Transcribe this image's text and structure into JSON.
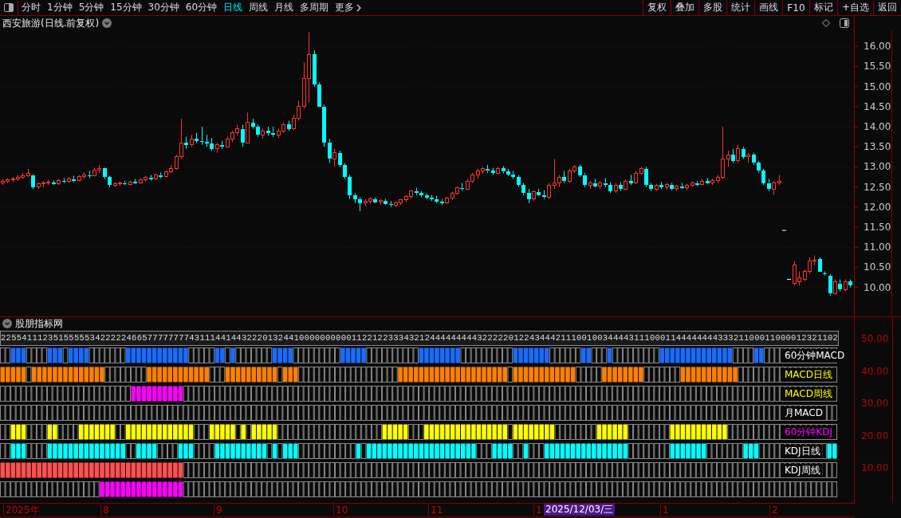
{
  "toolbar": {
    "periods": [
      {
        "label": "分时",
        "selected": false
      },
      {
        "label": "1分钟",
        "selected": false
      },
      {
        "label": "5分钟",
        "selected": false
      },
      {
        "label": "15分钟",
        "selected": false
      },
      {
        "label": "30分钟",
        "selected": false
      },
      {
        "label": "60分钟",
        "selected": false
      },
      {
        "label": "日线",
        "selected": true
      },
      {
        "label": "周线",
        "selected": false
      },
      {
        "label": "月线",
        "selected": false
      },
      {
        "label": "多周期",
        "selected": false
      }
    ],
    "more": "更多",
    "actions": [
      "复权",
      "叠加",
      "多股",
      "统计",
      "画线",
      "F10",
      "标记",
      "+自选",
      "返回"
    ]
  },
  "chart": {
    "title": "西安旅游(日线.前复权)",
    "chart_data": {
      "type": "candlestick",
      "ylim": [
        9.3,
        16.4
      ],
      "grid": true,
      "yticks": [
        {
          "value": 16,
          "label": "16.00"
        },
        {
          "value": 15.5,
          "label": "15.50"
        },
        {
          "value": 15,
          "label": "15.00"
        },
        {
          "value": 14.5,
          "label": "14.50"
        },
        {
          "value": 14,
          "label": "14.00"
        },
        {
          "value": 13.5,
          "label": "13.50"
        },
        {
          "value": 13,
          "label": "13.00"
        },
        {
          "value": 12.5,
          "label": "12.50"
        },
        {
          "value": 12,
          "label": "12.00"
        },
        {
          "value": 11.5,
          "label": "11.50"
        },
        {
          "value": 11,
          "label": "11.00"
        },
        {
          "value": 10.5,
          "label": "10.50"
        },
        {
          "value": 10,
          "label": "10.00"
        }
      ],
      "ohlc": [
        [
          12.6,
          12.7,
          12.55,
          12.65
        ],
        [
          12.65,
          12.72,
          12.6,
          12.68
        ],
        [
          12.68,
          12.75,
          12.62,
          12.7
        ],
        [
          12.7,
          12.8,
          12.65,
          12.75
        ],
        [
          12.75,
          12.85,
          12.7,
          12.78
        ],
        [
          12.78,
          12.95,
          12.75,
          12.85
        ],
        [
          12.8,
          12.82,
          12.45,
          12.5
        ],
        [
          12.5,
          12.62,
          12.45,
          12.58
        ],
        [
          12.58,
          12.65,
          12.5,
          12.6
        ],
        [
          12.6,
          12.68,
          12.55,
          12.62
        ],
        [
          12.62,
          12.66,
          12.55,
          12.58
        ],
        [
          12.58,
          12.7,
          12.55,
          12.66
        ],
        [
          12.66,
          12.72,
          12.6,
          12.64
        ],
        [
          12.64,
          12.75,
          12.6,
          12.7
        ],
        [
          12.7,
          12.78,
          12.62,
          12.66
        ],
        [
          12.66,
          12.8,
          12.64,
          12.76
        ],
        [
          12.76,
          12.86,
          12.7,
          12.8
        ],
        [
          12.8,
          12.9,
          12.72,
          12.78
        ],
        [
          12.78,
          12.98,
          12.76,
          12.92
        ],
        [
          12.92,
          13.05,
          12.85,
          12.96
        ],
        [
          12.96,
          12.98,
          12.7,
          12.75
        ],
        [
          12.75,
          12.78,
          12.5,
          12.55
        ],
        [
          12.55,
          12.62,
          12.5,
          12.58
        ],
        [
          12.58,
          12.64,
          12.52,
          12.6
        ],
        [
          12.6,
          12.65,
          12.55,
          12.57
        ],
        [
          12.57,
          12.66,
          12.54,
          12.63
        ],
        [
          12.63,
          12.7,
          12.58,
          12.6
        ],
        [
          12.6,
          12.72,
          12.58,
          12.68
        ],
        [
          12.68,
          12.78,
          12.64,
          12.74
        ],
        [
          12.74,
          12.8,
          12.66,
          12.7
        ],
        [
          12.7,
          12.84,
          12.68,
          12.8
        ],
        [
          12.8,
          12.86,
          12.72,
          12.76
        ],
        [
          12.76,
          12.92,
          12.74,
          12.88
        ],
        [
          12.88,
          13.05,
          12.85,
          12.95
        ],
        [
          12.95,
          13.3,
          12.93,
          13.25
        ],
        [
          13.25,
          14.2,
          13.2,
          13.6
        ],
        [
          13.6,
          13.75,
          13.45,
          13.55
        ],
        [
          13.55,
          13.8,
          13.5,
          13.7
        ],
        [
          13.7,
          13.85,
          13.6,
          13.65
        ],
        [
          13.65,
          14.0,
          13.55,
          13.62
        ],
        [
          13.62,
          13.8,
          13.5,
          13.58
        ],
        [
          13.58,
          13.72,
          13.4,
          13.45
        ],
        [
          13.45,
          13.6,
          13.35,
          13.55
        ],
        [
          13.55,
          13.65,
          13.45,
          13.5
        ],
        [
          13.5,
          13.75,
          13.48,
          13.7
        ],
        [
          13.7,
          13.9,
          13.62,
          13.85
        ],
        [
          13.85,
          14.05,
          13.78,
          13.95
        ],
        [
          13.95,
          14.05,
          13.5,
          13.6
        ],
        [
          13.6,
          14.35,
          13.58,
          14.1
        ],
        [
          14.1,
          14.2,
          13.95,
          14.0
        ],
        [
          14.0,
          14.05,
          13.75,
          13.8
        ],
        [
          13.8,
          13.95,
          13.7,
          13.9
        ],
        [
          13.9,
          14.0,
          13.78,
          13.85
        ],
        [
          13.85,
          14.0,
          13.75,
          13.8
        ],
        [
          13.8,
          13.95,
          13.72,
          13.9
        ],
        [
          13.9,
          14.1,
          13.85,
          14.05
        ],
        [
          14.05,
          14.15,
          13.9,
          13.95
        ],
        [
          13.95,
          14.3,
          13.92,
          14.2
        ],
        [
          14.2,
          14.65,
          14.15,
          14.5
        ],
        [
          14.5,
          15.6,
          14.45,
          15.2
        ],
        [
          15.2,
          16.35,
          14.6,
          15.8
        ],
        [
          15.8,
          15.9,
          15.0,
          15.05
        ],
        [
          15.05,
          15.1,
          14.5,
          14.5
        ],
        [
          14.5,
          14.55,
          13.5,
          13.6
        ],
        [
          13.6,
          13.7,
          13.1,
          13.2
        ],
        [
          13.2,
          13.45,
          13.0,
          13.35
        ],
        [
          13.35,
          13.4,
          13.0,
          13.05
        ],
        [
          13.05,
          13.1,
          12.7,
          12.75
        ],
        [
          12.75,
          12.8,
          12.2,
          12.3
        ],
        [
          12.3,
          12.35,
          12.1,
          12.2
        ],
        [
          12.2,
          12.25,
          11.9,
          12.1
        ],
        [
          12.1,
          12.2,
          12.02,
          12.15
        ],
        [
          12.15,
          12.25,
          12.08,
          12.2
        ],
        [
          12.2,
          12.24,
          12.1,
          12.12
        ],
        [
          12.12,
          12.2,
          12.05,
          12.16
        ],
        [
          12.16,
          12.2,
          12.06,
          12.08
        ],
        [
          12.08,
          12.15,
          12.0,
          12.05
        ],
        [
          12.05,
          12.14,
          12.0,
          12.1
        ],
        [
          12.1,
          12.2,
          12.05,
          12.18
        ],
        [
          12.18,
          12.3,
          12.12,
          12.26
        ],
        [
          12.26,
          12.42,
          12.22,
          12.4
        ],
        [
          12.4,
          12.48,
          12.3,
          12.35
        ],
        [
          12.35,
          12.4,
          12.25,
          12.3
        ],
        [
          12.3,
          12.34,
          12.2,
          12.24
        ],
        [
          12.24,
          12.3,
          12.15,
          12.2
        ],
        [
          12.2,
          12.28,
          12.1,
          12.14
        ],
        [
          12.14,
          12.2,
          12.05,
          12.1
        ],
        [
          12.1,
          12.25,
          12.08,
          12.22
        ],
        [
          12.22,
          12.38,
          12.18,
          12.35
        ],
        [
          12.35,
          12.52,
          12.3,
          12.48
        ],
        [
          12.48,
          12.6,
          12.4,
          12.45
        ],
        [
          12.45,
          12.7,
          12.42,
          12.65
        ],
        [
          12.65,
          12.85,
          12.6,
          12.8
        ],
        [
          12.8,
          12.95,
          12.7,
          12.9
        ],
        [
          12.9,
          13.0,
          12.82,
          12.95
        ],
        [
          12.95,
          13.05,
          12.85,
          12.9
        ],
        [
          12.9,
          12.98,
          12.8,
          12.85
        ],
        [
          12.85,
          13.0,
          12.82,
          12.96
        ],
        [
          12.96,
          13.02,
          12.84,
          12.88
        ],
        [
          12.88,
          12.95,
          12.78,
          12.82
        ],
        [
          12.82,
          12.9,
          12.7,
          12.75
        ],
        [
          12.75,
          12.8,
          12.5,
          12.55
        ],
        [
          12.55,
          12.6,
          12.3,
          12.35
        ],
        [
          12.35,
          12.45,
          12.1,
          12.2
        ],
        [
          12.2,
          12.42,
          12.15,
          12.38
        ],
        [
          12.38,
          12.45,
          12.28,
          12.3
        ],
        [
          12.3,
          12.42,
          12.2,
          12.25
        ],
        [
          12.25,
          12.6,
          12.2,
          12.55
        ],
        [
          12.55,
          13.2,
          12.45,
          12.6
        ],
        [
          12.6,
          12.8,
          12.5,
          12.75
        ],
        [
          12.75,
          12.9,
          12.6,
          12.65
        ],
        [
          12.65,
          12.95,
          12.6,
          12.9
        ],
        [
          12.9,
          13.05,
          12.85,
          13.0
        ],
        [
          13.0,
          13.05,
          12.75,
          12.8
        ],
        [
          12.8,
          12.85,
          12.5,
          12.55
        ],
        [
          12.55,
          12.65,
          12.45,
          12.6
        ],
        [
          12.6,
          12.7,
          12.5,
          12.52
        ],
        [
          12.52,
          12.65,
          12.45,
          12.6
        ],
        [
          12.6,
          12.72,
          12.5,
          12.55
        ],
        [
          12.55,
          12.62,
          12.35,
          12.4
        ],
        [
          12.4,
          12.6,
          12.35,
          12.55
        ],
        [
          12.55,
          12.62,
          12.4,
          12.45
        ],
        [
          12.45,
          12.7,
          12.42,
          12.65
        ],
        [
          12.65,
          12.8,
          12.55,
          12.6
        ],
        [
          12.6,
          12.9,
          12.58,
          12.85
        ],
        [
          12.85,
          13.0,
          12.8,
          12.95
        ],
        [
          12.95,
          13.0,
          12.5,
          12.55
        ],
        [
          12.55,
          12.6,
          12.4,
          12.45
        ],
        [
          12.45,
          12.58,
          12.4,
          12.55
        ],
        [
          12.55,
          12.62,
          12.45,
          12.5
        ],
        [
          12.5,
          12.6,
          12.44,
          12.56
        ],
        [
          12.56,
          12.6,
          12.42,
          12.46
        ],
        [
          12.46,
          12.55,
          12.4,
          12.52
        ],
        [
          12.52,
          12.6,
          12.45,
          12.48
        ],
        [
          12.48,
          12.58,
          12.42,
          12.55
        ],
        [
          12.55,
          12.64,
          12.5,
          12.6
        ],
        [
          12.6,
          12.65,
          12.52,
          12.56
        ],
        [
          12.56,
          12.7,
          12.54,
          12.65
        ],
        [
          12.65,
          12.72,
          12.58,
          12.6
        ],
        [
          12.6,
          12.7,
          12.55,
          12.66
        ],
        [
          12.66,
          12.8,
          12.6,
          12.75
        ],
        [
          12.75,
          14.0,
          12.7,
          13.2
        ],
        [
          13.2,
          13.4,
          13.0,
          13.3
        ],
        [
          13.3,
          13.45,
          13.1,
          13.15
        ],
        [
          13.15,
          13.55,
          13.1,
          13.45
        ],
        [
          13.45,
          13.5,
          13.2,
          13.25
        ],
        [
          13.25,
          13.35,
          13.1,
          13.3
        ],
        [
          13.3,
          13.35,
          13.05,
          13.1
        ],
        [
          13.1,
          13.15,
          12.85,
          12.9
        ],
        [
          12.9,
          12.95,
          12.55,
          12.6
        ],
        [
          12.6,
          12.7,
          12.4,
          12.45
        ],
        [
          12.45,
          12.65,
          12.3,
          12.6
        ],
        [
          12.6,
          12.8,
          12.55,
          12.65
        ],
        [
          11.42,
          11.42,
          11.42,
          11.42
        ],
        [
          10.2,
          10.2,
          10.2,
          10.2
        ],
        [
          10.1,
          10.65,
          10.05,
          10.55
        ],
        [
          10.15,
          10.4,
          10.05,
          10.25
        ],
        [
          10.2,
          10.45,
          10.15,
          10.4
        ],
        [
          10.4,
          10.75,
          10.35,
          10.65
        ],
        [
          10.65,
          10.8,
          10.55,
          10.68
        ],
        [
          10.7,
          10.75,
          10.4,
          10.4
        ],
        [
          10.35,
          10.4,
          10.3,
          10.33
        ],
        [
          10.3,
          10.33,
          9.8,
          9.85
        ],
        [
          9.85,
          10.2,
          9.83,
          10.15
        ],
        [
          10.1,
          10.2,
          9.9,
          9.95
        ],
        [
          9.95,
          10.2,
          9.9,
          10.15
        ],
        [
          10.15,
          10.2,
          10.0,
          10.05
        ]
      ]
    }
  },
  "indicator": {
    "title": "股朋指标网",
    "digits": "2255411123515555534222224665777777774311144144322201324410000000000112212233343212444444444322222012243444211100100344443111000114444444433321100011000012321102",
    "rows": [
      {
        "label": {
          "text": "60分钟MACD",
          "color": "#ffffff"
        },
        "color": "#1a6cff"
      },
      {
        "label": {
          "text": "MACD日线",
          "color": "#ffff00"
        },
        "color": "#ff8000"
      },
      {
        "label": {
          "text": "MACD周线",
          "color": "#ffff00"
        },
        "color": "#ff00ff"
      },
      {
        "label": {
          "text": "月MACD",
          "color": "#ffffff"
        }
      },
      {
        "label": {
          "text": "60分钟KDJ",
          "color": "#ff00ff"
        },
        "color": "#ffff00"
      },
      {
        "label": {
          "text": "KDJ日线",
          "color": "#ffffff"
        },
        "color": "#00ffff"
      },
      {
        "label": {
          "text": "KDJ周线",
          "color": "#ffffff"
        },
        "color": "#ff5050"
      },
      {
        "color": "#ff00ff"
      }
    ],
    "axis_labels": [
      "50.00",
      "40.00",
      "30.00",
      "20.00",
      "10.00"
    ]
  },
  "time_axis": {
    "labels": [
      "2025年",
      "8",
      "9",
      "10",
      "11",
      "1",
      "1",
      "2"
    ],
    "cursor_date": "2025/12/03/三"
  }
}
